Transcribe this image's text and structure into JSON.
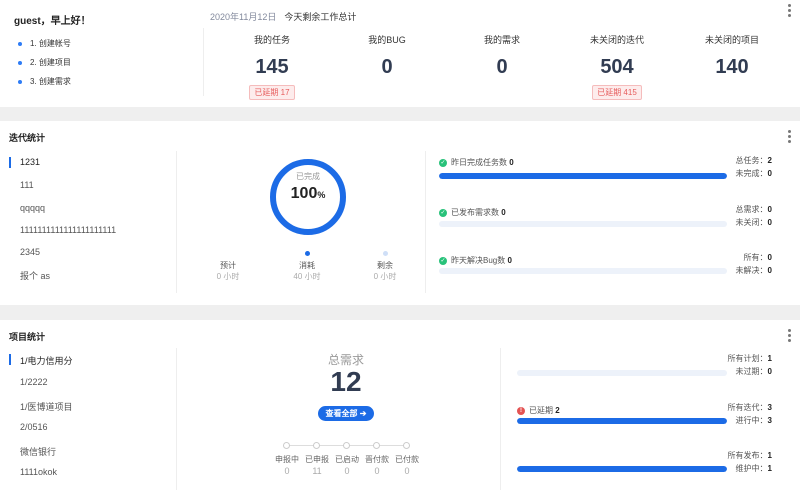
{
  "welcome": {
    "greeting": "guest，早上好！",
    "todos": [
      "1. 创建帐号",
      "2. 创建项目",
      "3. 创建需求"
    ],
    "date": "2020年11月12日",
    "summary_title": "今天剩余工作总计",
    "stats": [
      {
        "label": "我的任务",
        "value": "145",
        "badge": "已延期 17"
      },
      {
        "label": "我的BUG",
        "value": "0",
        "badge": ""
      },
      {
        "label": "我的需求",
        "value": "0",
        "badge": ""
      },
      {
        "label": "未关闭的迭代",
        "value": "504",
        "badge": "已延期 415"
      },
      {
        "label": "未关闭的项目",
        "value": "140",
        "badge": ""
      }
    ]
  },
  "iteration": {
    "title": "迭代统计",
    "items": [
      "1231",
      "111",
      "qqqqq",
      "1111111111111111111111",
      "2345",
      "报个 as"
    ],
    "ring": {
      "label": "已完成",
      "value": "100",
      "unit": "%",
      "fraction": 1.0
    },
    "timeline": [
      {
        "label": "预计",
        "value": "0",
        "unit": "小时"
      },
      {
        "label": "消耗",
        "value": "40",
        "unit": "小时"
      },
      {
        "label": "剩余",
        "value": "0",
        "unit": "小时"
      }
    ],
    "progress": [
      {
        "label": "昨日完成任务数",
        "value": "0",
        "fraction": 1.0,
        "right": [
          {
            "label": "总任务：",
            "value": "2"
          },
          {
            "label": "未完成：",
            "value": "0"
          }
        ]
      },
      {
        "label": "已发布需求数",
        "value": "0",
        "fraction": 0.0,
        "right": [
          {
            "label": "总需求：",
            "value": "0"
          },
          {
            "label": "未关闭：",
            "value": "0"
          }
        ]
      },
      {
        "label": "昨天解决Bug数",
        "value": "0",
        "fraction": 0.0,
        "right": [
          {
            "label": "所有：",
            "value": "0"
          },
          {
            "label": "未解决：",
            "value": "0"
          }
        ]
      }
    ]
  },
  "project": {
    "title": "项目统计",
    "items": [
      "1/电力信用分",
      "1/2222",
      "1/医博道项目",
      "2/0516",
      "微信银行",
      "1111okok"
    ],
    "total_label": "总需求",
    "total_value": "12",
    "view_all": "查看全部",
    "stages": [
      {
        "label": "申报中",
        "value": "0"
      },
      {
        "label": "已申报",
        "value": "11"
      },
      {
        "label": "已启动",
        "value": "0"
      },
      {
        "label": "晋付款",
        "value": "0"
      },
      {
        "label": "已付款",
        "value": "0"
      }
    ],
    "progress": [
      {
        "label": "",
        "value": "",
        "fraction": 0.0,
        "right": [
          {
            "label": "所有计划：",
            "value": "1"
          },
          {
            "label": "未过期：",
            "value": "0"
          }
        ]
      },
      {
        "label": "已延期",
        "value": "2",
        "fraction": 1.0,
        "right": [
          {
            "label": "所有迭代：",
            "value": "3"
          },
          {
            "label": "进行中：",
            "value": "3"
          }
        ]
      },
      {
        "label": "",
        "value": "",
        "fraction": 1.0,
        "right": [
          {
            "label": "所有发布：",
            "value": "1"
          },
          {
            "label": "维护中：",
            "value": "1"
          }
        ]
      }
    ]
  },
  "colors": {
    "accent": "#1c6be6",
    "success": "#28c27a",
    "danger": "#e45353"
  }
}
